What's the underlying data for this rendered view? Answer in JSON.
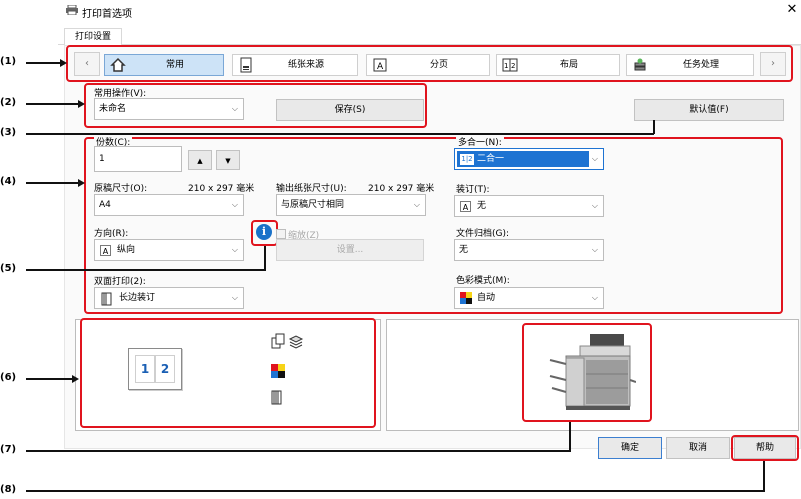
{
  "window": {
    "title": "打印首选项",
    "close_glyph": "✕"
  },
  "tabs": [
    {
      "label": "打印设置"
    }
  ],
  "ribbon": {
    "prev_glyph": "‹",
    "next_glyph": "›",
    "items": [
      {
        "label": "常用",
        "icon": "home-icon",
        "selected": true
      },
      {
        "label": "纸张来源",
        "icon": "paper-tray-icon",
        "selected": false
      },
      {
        "label": "分页",
        "icon": "page-icon",
        "selected": false
      },
      {
        "label": "布局",
        "icon": "layout-icon",
        "selected": false
      },
      {
        "label": "任务处理",
        "icon": "job-handling-icon",
        "selected": false
      }
    ]
  },
  "favorites": {
    "label": "常用操作(V):",
    "value": "未命名",
    "save_label": "保存(S)"
  },
  "defaults_label": "默认值(F)",
  "copies": {
    "label": "份数(C):",
    "value": "1",
    "up": "▲",
    "down": "▼"
  },
  "original_size": {
    "label": "原稿尺寸(O):",
    "dims": "210 x 297 毫米",
    "value": "A4"
  },
  "output_size": {
    "label": "输出纸张尺寸(U):",
    "dims": "210 x 297 毫米",
    "value": "与原稿尺寸相同"
  },
  "orientation": {
    "label": "方向(R):",
    "value": "纵向",
    "icon_glyph": "A"
  },
  "info_glyph": "i",
  "zoom": {
    "label": "缩放(Z)",
    "settings_label": "设置..."
  },
  "duplex": {
    "label": "双面打印(2):",
    "value": "长边装订"
  },
  "nup": {
    "label": "多合一(N):",
    "value": "二合一",
    "icon_glyph": "1|2"
  },
  "staple": {
    "label": "装订(T):",
    "value": "无",
    "icon_glyph": "A"
  },
  "file_retention": {
    "label": "文件归档(G):",
    "value": "无"
  },
  "color_mode": {
    "label": "色彩模式(M):",
    "value": "自动"
  },
  "preview": {
    "page1": "1",
    "page2": "2"
  },
  "buttons": {
    "ok": "确定",
    "cancel": "取消",
    "help": "帮助"
  },
  "callouts": [
    "(1)",
    "(2)",
    "(3)",
    "(4)",
    "(5)",
    "(6)",
    "(7)",
    "(8)"
  ],
  "colors": {
    "accent_red": "#e0141e",
    "selection_blue": "#1e73d2",
    "tab_selected": "#cde3f7",
    "info_blue": "#1a72c9"
  }
}
